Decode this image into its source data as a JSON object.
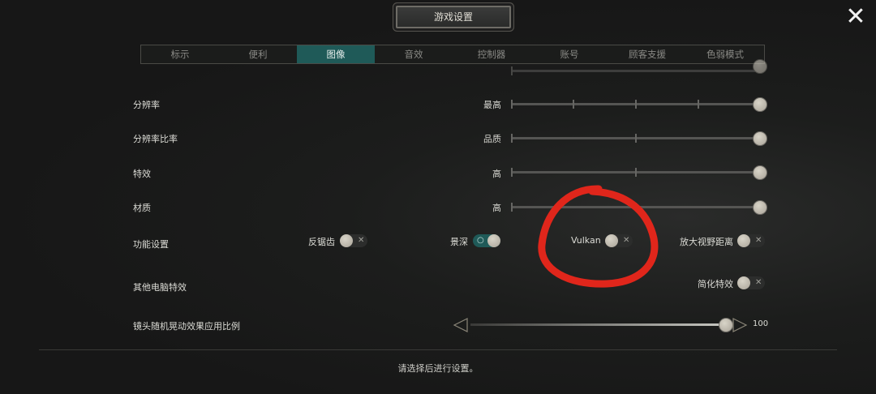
{
  "header": {
    "title": "游戏设置",
    "close_glyph": "✕"
  },
  "tabs": [
    {
      "label": "标示"
    },
    {
      "label": "便利"
    },
    {
      "label": "图像",
      "active": true
    },
    {
      "label": "音效"
    },
    {
      "label": "控制器"
    },
    {
      "label": "账号"
    },
    {
      "label": "顾客支援"
    },
    {
      "label": "色弱模式"
    }
  ],
  "rows": {
    "resolution": {
      "label": "分辨率",
      "value": "最高"
    },
    "resolution_ratio": {
      "label": "分辨率比率",
      "value": "品质"
    },
    "effects": {
      "label": "特效",
      "value": "高"
    },
    "texture": {
      "label": "材质",
      "value": "高"
    },
    "features": {
      "label": "功能设置"
    },
    "other_pc": {
      "label": "其他电脑特效"
    },
    "camera_shake": {
      "label": "镜头随机晃动效果应用比例",
      "value": "100"
    }
  },
  "sliders": {
    "resolution_level": 1.0,
    "resolution_ratio_level": 1.0,
    "effects_level": 1.0,
    "texture_level": 1.0,
    "camera_shake_percent": 100
  },
  "toggles": {
    "antialias": {
      "label": "反锯齿",
      "on": false
    },
    "depth_of_field": {
      "label": "景深",
      "on": true
    },
    "vulkan": {
      "label": "Vulkan",
      "on": false
    },
    "view_distance": {
      "label": "放大视野距离",
      "on": false
    },
    "simplified_effects": {
      "label": "简化特效",
      "on": false
    }
  },
  "footer": {
    "hint": "请选择后进行设置。"
  },
  "colors": {
    "accent": "#1f5a58",
    "annotation": "#e0261b"
  }
}
